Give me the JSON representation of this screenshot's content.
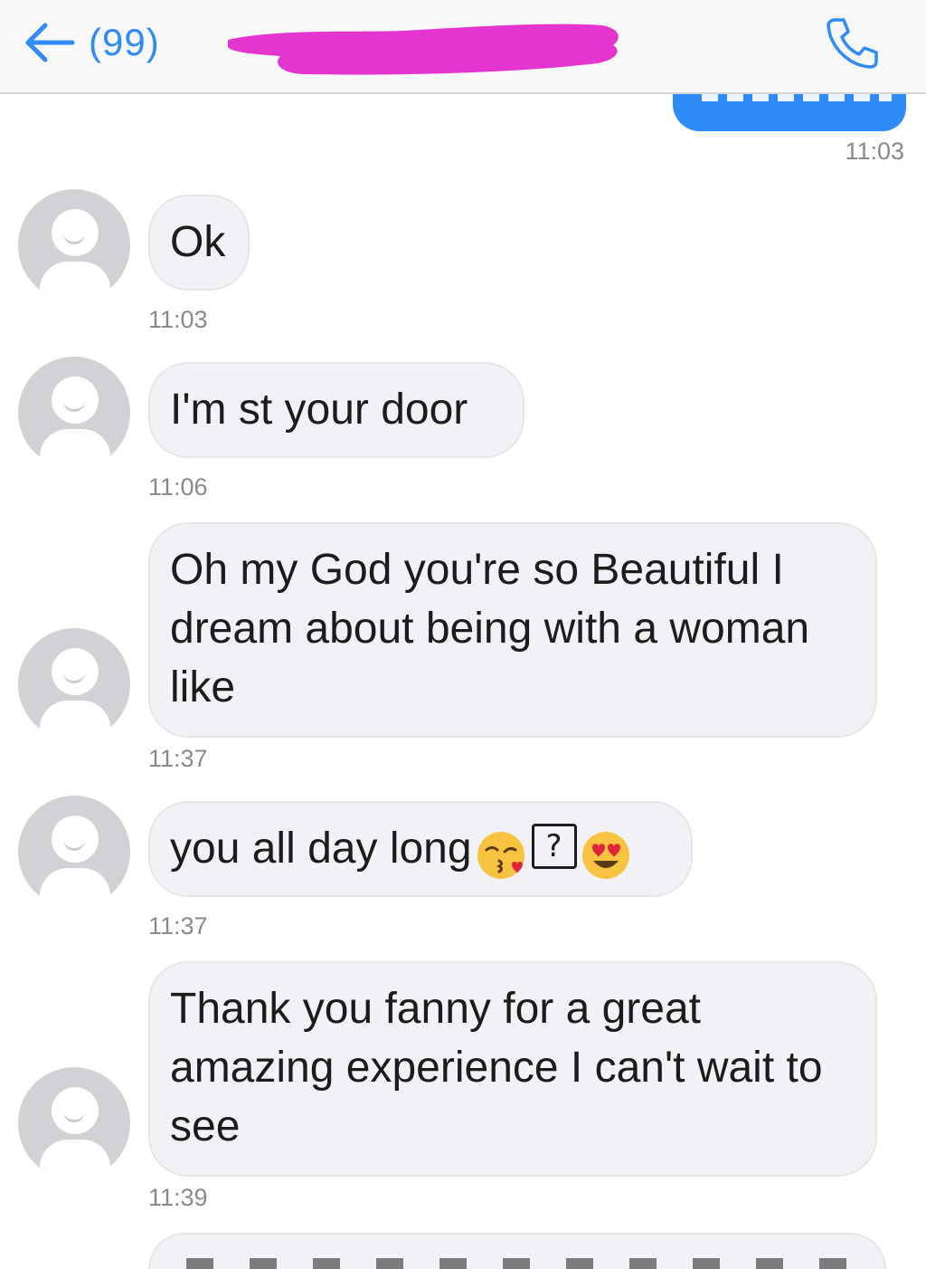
{
  "header": {
    "unread_count": "(99)",
    "contact_name": "",
    "colors": {
      "accent": "#2f8bf5",
      "redaction": "#e535cf"
    },
    "icons": {
      "back": "back-arrow-icon",
      "call": "phone-icon"
    }
  },
  "outgoing": {
    "last_time": "11:03",
    "bubble_color": "#2f8bf5"
  },
  "messages": [
    {
      "text": "Ok",
      "time": "11:03"
    },
    {
      "text": "I'm st your door",
      "time": "11:06"
    },
    {
      "text": "Oh my God you're so Beautiful I dream about being with a woman like",
      "time": "11:37"
    },
    {
      "text": "you all day long",
      "time": "11:37",
      "trailing": [
        "face-blowing-kiss-emoji",
        "missing-character-box",
        "smiling-face-heart-eyes-emoji"
      ],
      "missing_glyph": "?"
    },
    {
      "text": "Thank you fanny for a great amazing experience I can't wait to see",
      "time": "11:39"
    }
  ],
  "theme": {
    "incoming_bubble": "#f2f2f6",
    "timestamp": "#8a8a8e",
    "avatar": "#d1d1d6"
  }
}
